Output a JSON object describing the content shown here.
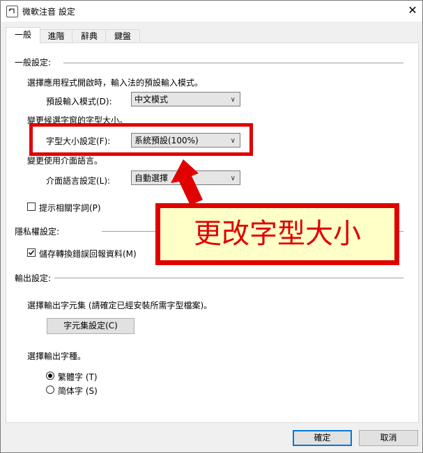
{
  "window": {
    "title": "微軟注音 設定",
    "close_glyph": "✕"
  },
  "tabs": [
    "一般",
    "進階",
    "辭典",
    "鍵盤"
  ],
  "general_section": {
    "title": "一般設定:",
    "default_mode_desc": "選擇應用程式開啟時，輸入法的預設輸入模式。",
    "default_mode_label": "預設輸入模式(D):",
    "default_mode_value": "中文模式",
    "font_size_desc": "變更候選字窗的字型大小。",
    "font_size_label": "字型大小設定(F):",
    "font_size_value": "系統預設(100%)",
    "ui_lang_desc": "變更使用介面語言。",
    "ui_lang_label": "介面語言設定(L):",
    "ui_lang_value": "自動選擇",
    "hint_related_label": "提示相關字詞(P)",
    "hint_related_checked": false
  },
  "privacy_section": {
    "title": "隱私權設定:",
    "save_errors_label": "儲存轉換錯誤回報資料(M)",
    "save_errors_checked": true
  },
  "output_section": {
    "title": "輸出設定:",
    "charset_desc": "選擇輸出字元集 (請確定已經安裝所需字型檔案)。",
    "charset_button": "字元集設定(C)",
    "glyph_desc": "選擇輸出字種。",
    "traditional_label": "繁體字 (T)",
    "simplified_label": "简体字 (S)",
    "selected": "traditional"
  },
  "buttons": {
    "ok": "確定",
    "cancel": "取消"
  },
  "annotation": {
    "callout_text": "更改字型大小",
    "highlight_color": "#e00000",
    "callout_bg": "#ffffc8"
  }
}
